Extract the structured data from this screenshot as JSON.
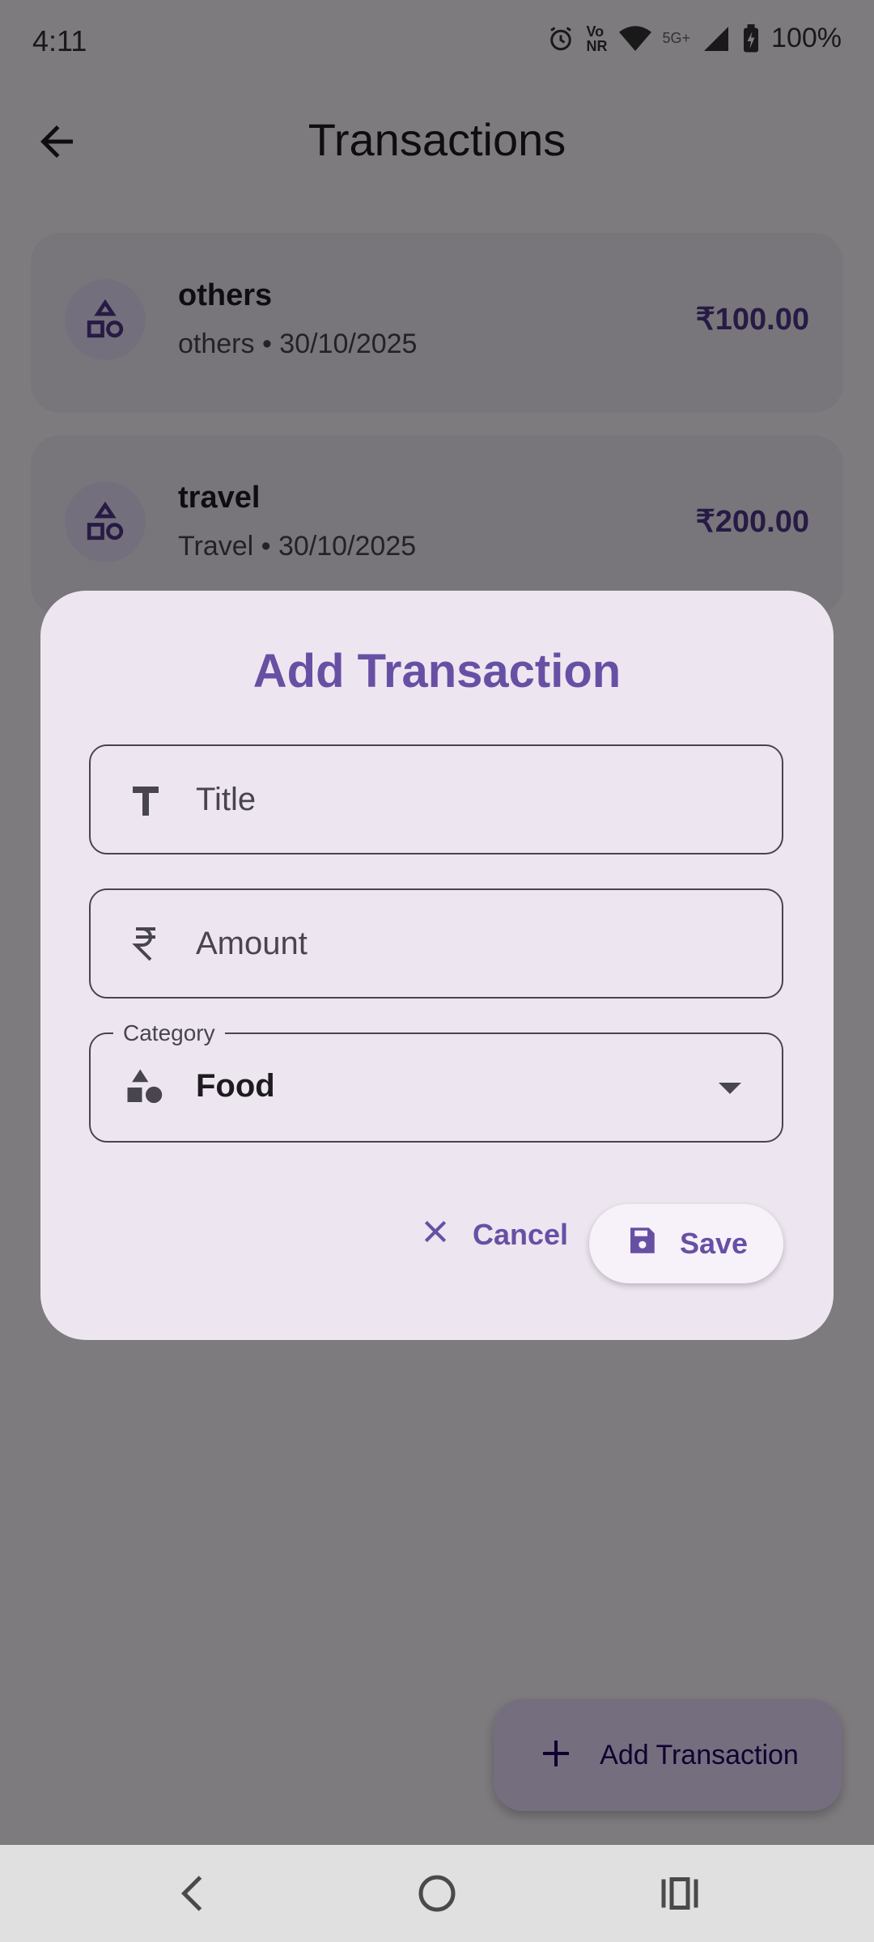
{
  "status_bar": {
    "time": "4:11",
    "battery": "100%",
    "network": "5G+",
    "volte": "Vo\nNR",
    "icons": [
      "alarm-icon",
      "volte-icon",
      "wifi-icon",
      "signal-icon",
      "battery-charging-icon"
    ]
  },
  "app_bar": {
    "title": "Transactions",
    "back_icon": "arrow-back-icon"
  },
  "transactions": [
    {
      "title": "others",
      "subtitle": "others • 30/10/2025",
      "amount": "₹100.00",
      "icon": "category-shapes-icon"
    },
    {
      "title": "travel",
      "subtitle": "Travel • 30/10/2025",
      "amount": "₹200.00",
      "icon": "category-shapes-icon"
    }
  ],
  "fab": {
    "label": "Add Transaction",
    "icon": "plus-icon"
  },
  "dialog": {
    "title": "Add Transaction",
    "title_field": {
      "placeholder": "Title",
      "icon": "text-title-icon"
    },
    "amount_field": {
      "placeholder": "Amount",
      "icon": "rupee-icon"
    },
    "category_field": {
      "label": "Category",
      "value": "Food",
      "icon": "category-shapes-icon"
    },
    "cancel_label": "Cancel",
    "save_label": "Save"
  },
  "nav_bar": {
    "buttons": [
      "back-nav-icon",
      "home-nav-icon",
      "recents-nav-icon"
    ]
  },
  "colors": {
    "primary": "#6750A4",
    "scrim": "#000000",
    "dialog_bg": "#EDE6F0",
    "amount": "#4F378B"
  }
}
